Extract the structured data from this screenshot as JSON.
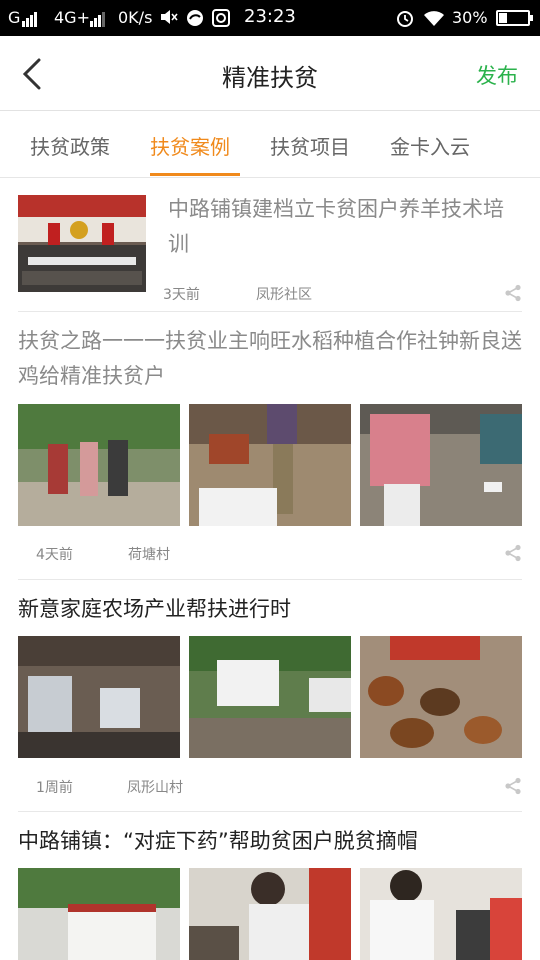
{
  "status_bar": {
    "carrier": "G",
    "network": "4G+",
    "speed": "0K/s",
    "time": "23:23",
    "battery_percent": "30%",
    "battery_level": 0.3,
    "icons": [
      "signal-icon",
      "mute-icon",
      "sync-icon",
      "vpn-icon",
      "alarm-icon",
      "wifi-icon",
      "battery-icon"
    ]
  },
  "header": {
    "title": "精准扶贫",
    "publish_label": "发布",
    "back_icon": "chevron-left-icon",
    "accent_color": "#2bb24c"
  },
  "tabs": {
    "active_color": "#f08a1c",
    "items": [
      {
        "label": "扶贫政策",
        "active": false
      },
      {
        "label": "扶贫案例",
        "active": true
      },
      {
        "label": "扶贫项目",
        "active": false
      },
      {
        "label": "金卡入云",
        "active": false
      }
    ]
  },
  "feed": [
    {
      "title": "中路铺镇建档立卡贫困户养羊技术培训",
      "time": "3天前",
      "location": "凤形社区",
      "layout": "single-image",
      "read": true
    },
    {
      "title": "扶贫之路一一一扶贫业主响旺水稻种植合作社钟新良送鸡给精准扶贫户",
      "time": "4天前",
      "location": "荷塘村",
      "layout": "three-images",
      "read": true
    },
    {
      "title": "新意家庭农场产业帮扶进行时",
      "time": "1周前",
      "location": "凤形山村",
      "layout": "three-images",
      "read": false
    },
    {
      "title": "中路铺镇：“对症下药”帮助贫困户脱贫摘帽",
      "layout": "three-images",
      "read": false
    }
  ]
}
